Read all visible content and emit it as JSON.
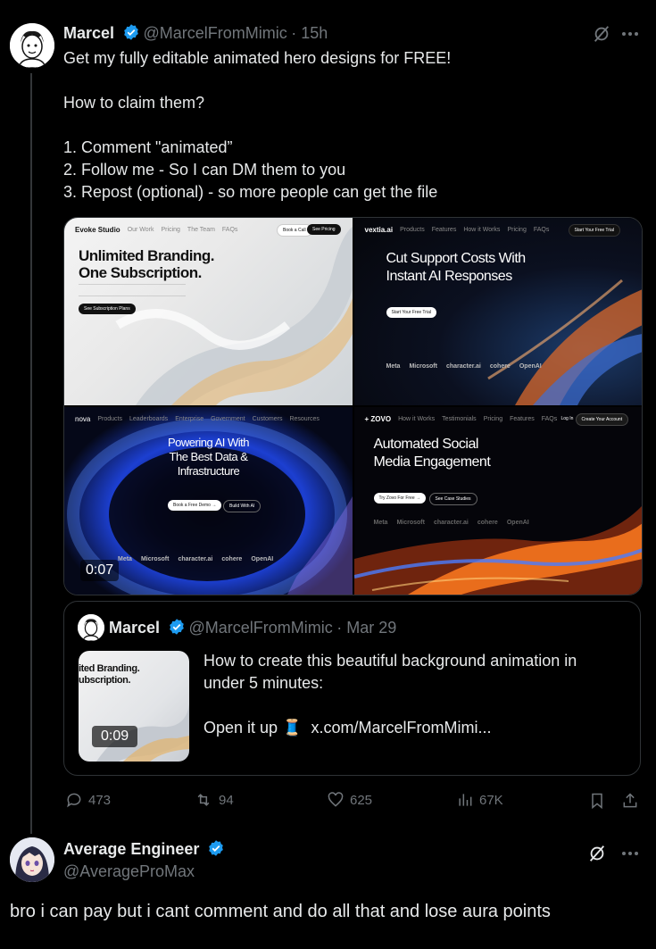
{
  "main_tweet": {
    "author_name": "Marcel",
    "author_handle": "@MarcelFromMimic",
    "time": "· 15h",
    "text": "Get my fully editable animated hero designs for FREE!\n\nHow to claim them?\n\n1. Comment \"animated”\n2. Follow me - So I can DM them to you\n3. Repost (optional) - so more people can get the file",
    "video_duration": "0:07",
    "media": {
      "tile1": {
        "brand": "Evoke Studio",
        "headline": "Unlimited Branding.\nOne Subscription.",
        "cta": "See Subscription Plans",
        "btn1": "Book a Call",
        "btn2": "See Pricing"
      },
      "tile2": {
        "brand": "vextia.ai",
        "headline": "Cut Support Costs With\nInstant AI Responses",
        "cta": "Start Your Free Trial",
        "btn": "Start Your Free Trial",
        "logos": [
          "Meta",
          "Microsoft",
          "character.ai",
          "cohere",
          "OpenAI"
        ]
      },
      "tile3": {
        "brand": "nova",
        "headline": "Powering AI With\nThe Best Data &\nInfrastructure",
        "cta1": "Book a Free Demo →",
        "cta2": "Build With AI",
        "logos": [
          "Meta",
          "Microsoft",
          "character.ai",
          "cohere",
          "OpenAI"
        ]
      },
      "tile4": {
        "brand": "+ ZOVO",
        "headline": "Automated Social\nMedia Engagement",
        "cta1": "Try Zovo For Free →",
        "cta2": "See Case Studies",
        "login": "Log In",
        "btn": "Create Your Account",
        "logos": [
          "Meta",
          "Microsoft",
          "character.ai",
          "cohere",
          "OpenAI"
        ]
      }
    }
  },
  "quote_tweet": {
    "author_name": "Marcel",
    "author_handle": "@MarcelFromMimic",
    "time": "· Mar 29",
    "text_line1": "How to create this beautiful background animation in",
    "text_line2": "under 5 minutes:",
    "text_line3": "Open it up 🧵  x.com/MarcelFromMimi...",
    "thumb_headline": "ited Branding.\nubscription.",
    "video_duration": "0:09"
  },
  "actions": {
    "replies": "473",
    "reposts": "94",
    "likes": "625",
    "views": "67K"
  },
  "reply": {
    "author_name": "Average Engineer",
    "author_handle": "@AverageProMax",
    "text": "bro i can pay but i cant comment and do all that and lose aura points"
  },
  "colors": {
    "verified": "#1d9bf0",
    "muted": "#71767b",
    "border": "#2f3336"
  }
}
